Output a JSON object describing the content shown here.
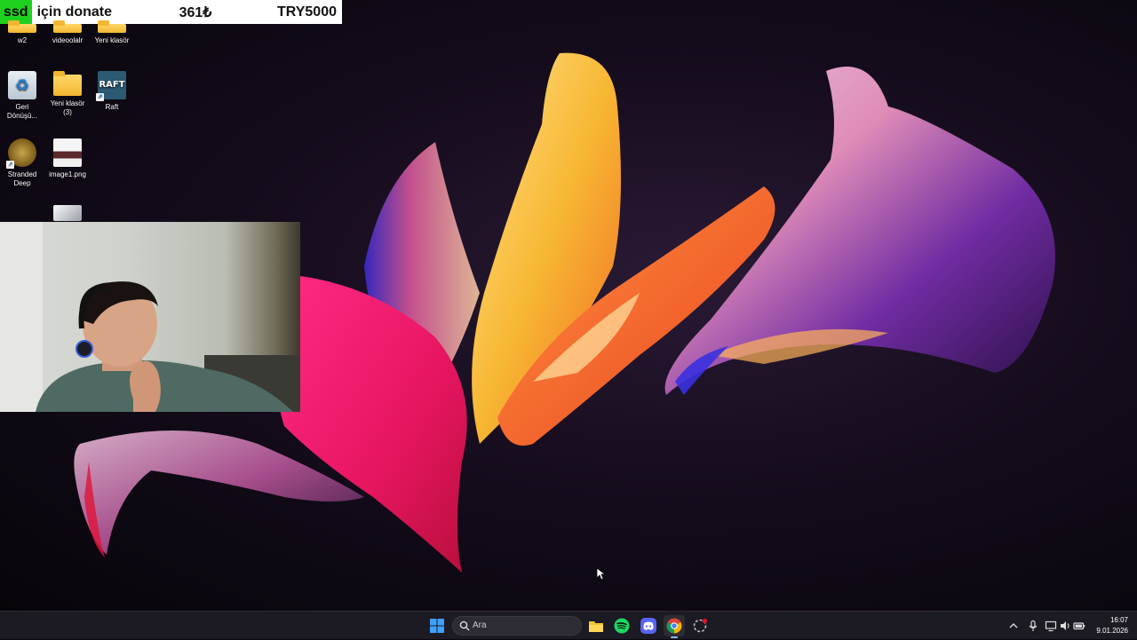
{
  "donation": {
    "user": "ssd",
    "message": "için donate",
    "amount": "361₺",
    "goal": "TRY5000"
  },
  "desktop_icons": [
    {
      "label": "w2",
      "icon": "folder-icon"
    },
    {
      "label": "videoolalr",
      "icon": "folder-icon"
    },
    {
      "label": "Yeni klasör",
      "icon": "folder-icon"
    },
    {
      "label": "Geri Dönüşü...",
      "icon": "recycle-bin-icon"
    },
    {
      "label": "Yeni klasör (3)",
      "icon": "folder-icon"
    },
    {
      "label": "Raft",
      "icon": "raft-game-icon"
    },
    {
      "label": "Stranded Deep",
      "icon": "stranded-deep-icon"
    },
    {
      "label": "image1.png",
      "icon": "image-file-icon"
    }
  ],
  "raft_glyph": "RAFT",
  "taskbar": {
    "search_placeholder": "Ara",
    "apps": [
      "windows-start-icon",
      "file-explorer-icon",
      "spotify-icon",
      "discord-icon",
      "chrome-icon",
      "app-icon"
    ],
    "time": "16:07",
    "date": "9.01.2026"
  },
  "colors": {
    "donate_user_bg": "#1fd11f",
    "taskbar_bg": "#1c1a22",
    "accent": "#8fb4ff"
  }
}
